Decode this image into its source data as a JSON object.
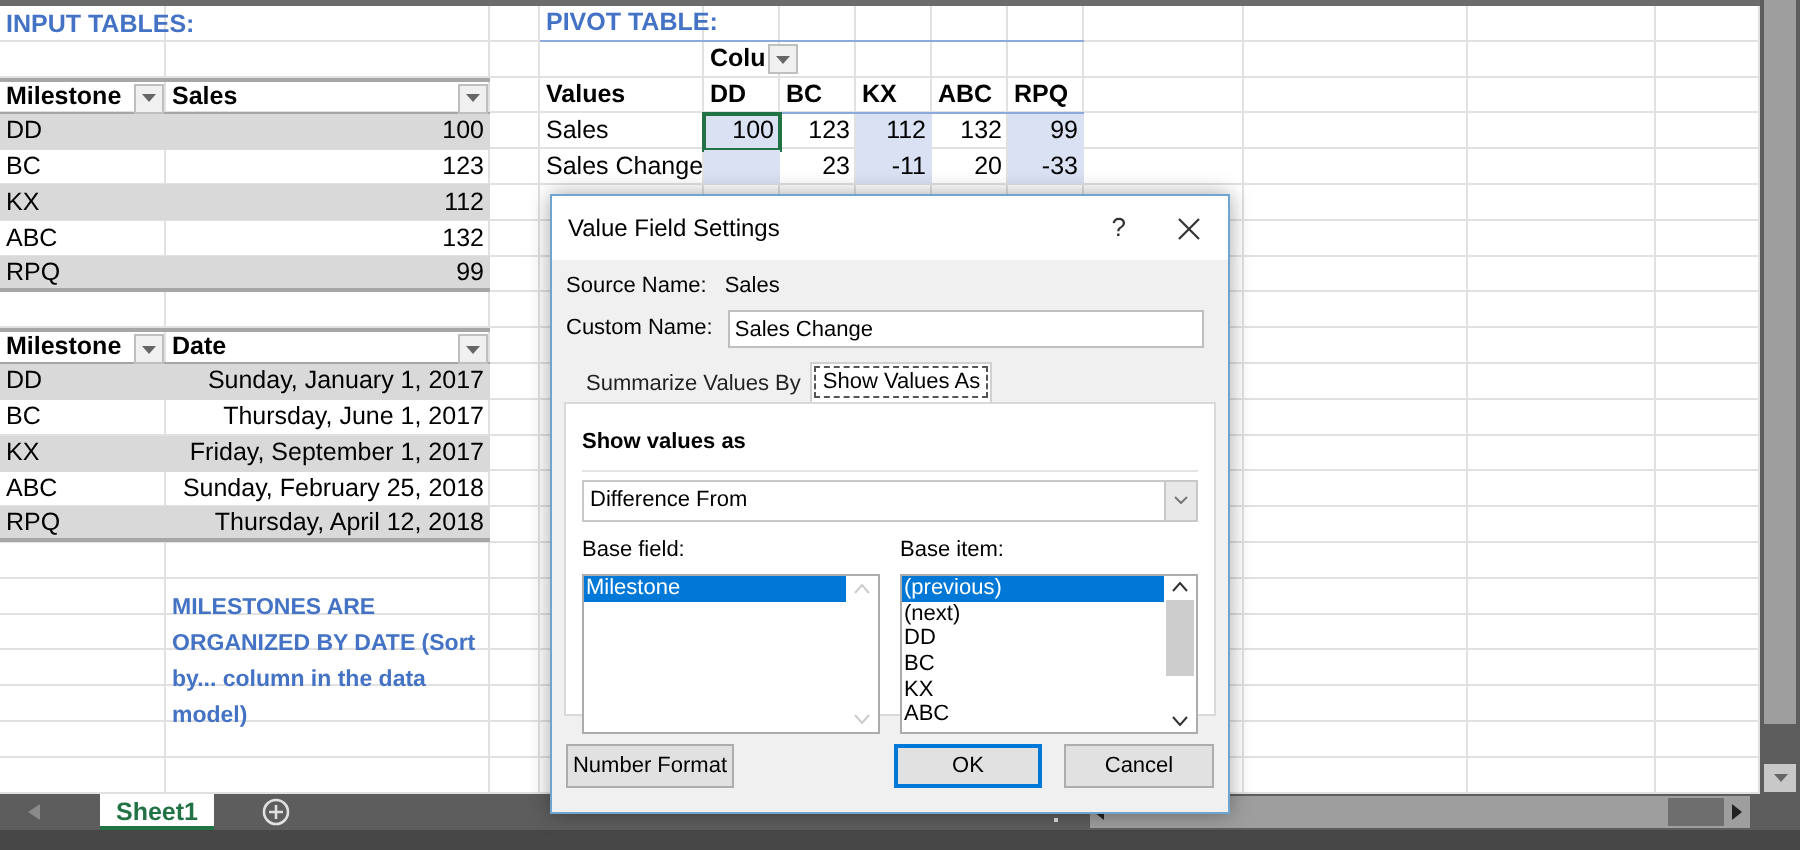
{
  "input_title": "INPUT TABLES:",
  "sales_table": {
    "columns": [
      {
        "label": "Milestone"
      },
      {
        "label": "Sales"
      }
    ],
    "rows": [
      {
        "milestone": "DD",
        "value": "100"
      },
      {
        "milestone": "BC",
        "value": "123"
      },
      {
        "milestone": "KX",
        "value": "112"
      },
      {
        "milestone": "ABC",
        "value": "132"
      },
      {
        "milestone": "RPQ",
        "value": "99"
      }
    ]
  },
  "dates_table": {
    "columns": [
      {
        "label": "Milestone"
      },
      {
        "label": "Date"
      }
    ],
    "rows": [
      {
        "milestone": "DD",
        "value": "Sunday, January 1, 2017"
      },
      {
        "milestone": "BC",
        "value": "Thursday, June 1, 2017"
      },
      {
        "milestone": "KX",
        "value": "Friday, September 1, 2017"
      },
      {
        "milestone": "ABC",
        "value": "Sunday, February 25, 2018"
      },
      {
        "milestone": "RPQ",
        "value": "Thursday, April 12, 2018"
      }
    ]
  },
  "note": "MILESTONES ARE ORGANIZED BY DATE (Sort by... column in the data model)",
  "pivot": {
    "title": "PIVOT TABLE:",
    "column_label": "Colu",
    "values_label": "Values",
    "headers": [
      "DD",
      "BC",
      "KX",
      "ABC",
      "RPQ"
    ],
    "rows": [
      {
        "label": "Sales",
        "cells": [
          {
            "text": "100",
            "selected": true
          },
          {
            "text": "123",
            "selected": false
          },
          {
            "text": "112",
            "selected": false
          },
          {
            "text": "132",
            "selected": false
          },
          {
            "text": "99",
            "selected": false
          }
        ]
      },
      {
        "label": "Sales Change",
        "cells": [
          {
            "text": null,
            "selected": false
          },
          {
            "text": "23",
            "selected": false
          },
          {
            "text": "-11",
            "selected": false
          },
          {
            "text": "20",
            "selected": false
          },
          {
            "text": "-33",
            "selected": false
          }
        ]
      }
    ]
  },
  "dialog": {
    "title": "Value Field Settings",
    "help": "?",
    "source_label": "Source Name:",
    "source_value": "Sales",
    "custom_label": "Custom Name:",
    "custom_value": "Sales Change",
    "tabs": [
      {
        "label": "Summarize Values By",
        "selected": false
      },
      {
        "label": "Show Values As",
        "selected": true
      }
    ],
    "section_title": "Show values as",
    "show_as_value": "Difference From",
    "base_field_label": "Base field:",
    "base_fields": [
      {
        "label": "Milestone",
        "selected": true
      }
    ],
    "base_item_label": "Base item:",
    "base_items": [
      {
        "label": "(previous)",
        "selected": true
      },
      {
        "label": "(next)",
        "selected": false
      },
      {
        "label": "DD",
        "selected": false
      },
      {
        "label": "BC",
        "selected": false
      },
      {
        "label": "KX",
        "selected": false
      },
      {
        "label": "ABC",
        "selected": false
      }
    ],
    "buttons": [
      {
        "label": "Number Format",
        "kind": "secondary"
      },
      {
        "label": "OK",
        "kind": "default"
      },
      {
        "label": "Cancel",
        "kind": "secondary"
      }
    ]
  },
  "sheet_tabs": [
    {
      "label": "Sheet1",
      "selected": true
    }
  ]
}
